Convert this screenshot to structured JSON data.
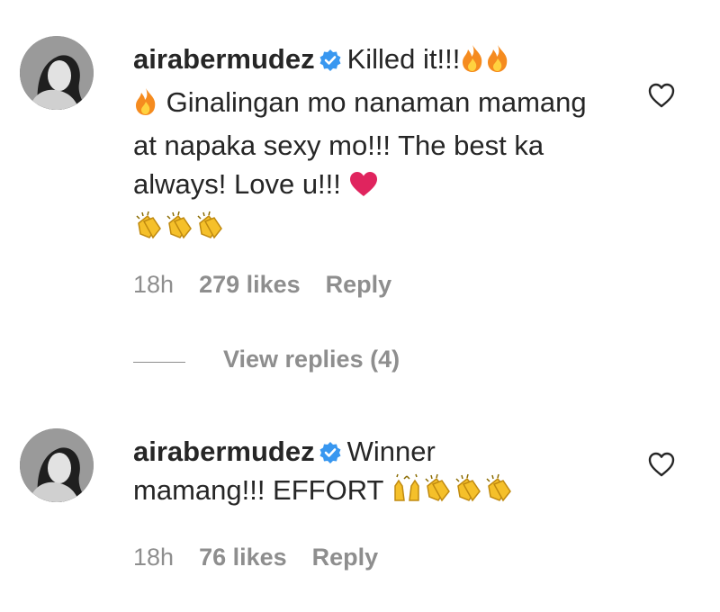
{
  "comments": [
    {
      "username": "airabermudez",
      "text_line1": "Killed it!!!",
      "text_rest": "Ginalingan mo nanaman mamang at napaka sexy mo!!! The best ka always! Love u!!!",
      "time": "18h",
      "likes": "279 likes",
      "reply": "Reply"
    },
    {
      "username": "airabermudez",
      "text_line1": "Winner",
      "text_rest": "mamang!!! EFFORT",
      "time": "18h",
      "likes": "76 likes",
      "reply": "Reply"
    }
  ],
  "view_replies": "View replies (4)",
  "colors": {
    "text": "#262626",
    "muted": "#8e8e8e",
    "verified": "#3897f0",
    "fire": "#f58b1f",
    "heart": "#e0245e",
    "clap": "#f5c02a"
  },
  "icons": [
    "verified-badge-icon",
    "fire-emoji-icon",
    "red-heart-emoji-icon",
    "clapping-hands-emoji-icon",
    "raising-hands-emoji-icon",
    "heart-outline-icon"
  ]
}
